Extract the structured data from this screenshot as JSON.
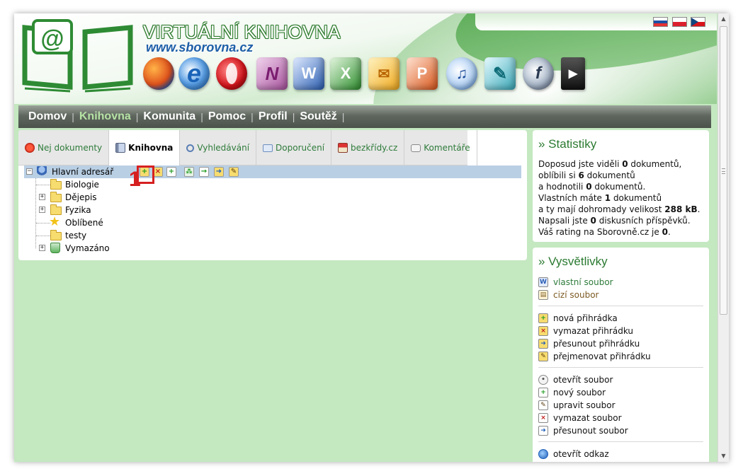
{
  "header": {
    "site_title": "VIRTUÁLNÍ KNIHOVNA",
    "site_url": "www.sborovna.cz",
    "app_icons": [
      "firefox-icon",
      "ie-icon",
      "opera-icon",
      "onenote-icon",
      "word-icon",
      "excel-icon",
      "outlook-icon",
      "powerpoint-icon",
      "itunes-icon",
      "publisher-icon",
      "flash-icon",
      "avi-icon"
    ],
    "flags": [
      "slovak-flag",
      "polish-flag",
      "czech-flag"
    ]
  },
  "nav": {
    "items": [
      "Domov",
      "Knihovna",
      "Komunita",
      "Pomoc",
      "Profil",
      "Soutěž"
    ],
    "active": "Knihovna"
  },
  "tabs": [
    {
      "label": "Nej dokumenty",
      "icon": "award-icon"
    },
    {
      "label": "Knihovna",
      "icon": "book-icon",
      "active": true
    },
    {
      "label": "Vyhledávání",
      "icon": "magnifier-icon"
    },
    {
      "label": "Doporučení",
      "icon": "envelope-icon"
    },
    {
      "label": "bezkřídy.cz",
      "icon": "home-icon"
    },
    {
      "label": "Komentáře",
      "icon": "comment-icon"
    }
  ],
  "tree": {
    "root": "Hlavní adresář",
    "items": [
      "Biologie",
      "Dějepis",
      "Fyzika",
      "Oblíbené",
      "testy",
      "Vymazáno"
    ]
  },
  "callout": {
    "number": "1"
  },
  "stats": {
    "title": "» Statistiky",
    "line1_a": "Doposud jste viděli ",
    "line1_b": "0",
    "line1_c": " dokumentů,",
    "line2_a": "oblíbili si ",
    "line2_b": "6",
    "line2_c": " dokumentů",
    "line3_a": "a hodnotili ",
    "line3_b": "0",
    "line3_c": " dokumentů.",
    "line4_a": "Vlastních máte ",
    "line4_b": "1",
    "line4_c": " dokumentů",
    "line5_a": "a ty mají dohromady velikost ",
    "line5_b": "288 kB",
    "line5_c": ".",
    "line6_a": "Napsali jste ",
    "line6_b": "0",
    "line6_c": " diskusních příspěvků.",
    "line7_a": "Váš rating na Sborovně.cz je ",
    "line7_b": "0",
    "line7_c": "."
  },
  "legend": {
    "title": "» Vysvětlivky",
    "files": [
      {
        "label": "vlastní soubor",
        "icon": "word-file-icon"
      },
      {
        "label": "cizí soubor",
        "icon": "foreign-file-icon"
      }
    ],
    "folders": [
      {
        "label": "nová přihrádka",
        "icon": "new-folder-icon"
      },
      {
        "label": "vymazat přihrádku",
        "icon": "delete-folder-icon"
      },
      {
        "label": "přesunout přihrádku",
        "icon": "move-folder-icon"
      },
      {
        "label": "přejmenovat přihrádku",
        "icon": "rename-folder-icon"
      }
    ],
    "file_actions": [
      {
        "label": "otevřít soubor",
        "icon": "open-file-icon"
      },
      {
        "label": "nový soubor",
        "icon": "new-file-icon"
      },
      {
        "label": "upravit soubor",
        "icon": "edit-file-icon"
      },
      {
        "label": "vymazat soubor",
        "icon": "delete-file-icon"
      },
      {
        "label": "přesunout soubor",
        "icon": "move-file-icon"
      }
    ],
    "links": [
      {
        "label": "otevřít odkaz",
        "icon": "globe-icon"
      }
    ]
  },
  "colors": {
    "page_bg": "#c4e8c0",
    "accent_green": "#2b7a31",
    "callout_red": "#d62020",
    "nav_active": "#b6e3a5"
  }
}
